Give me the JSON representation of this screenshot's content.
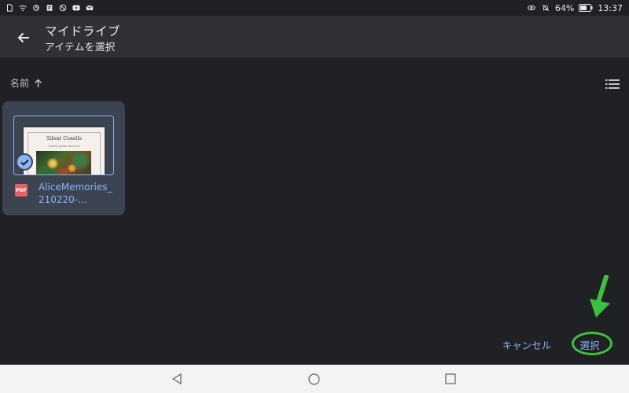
{
  "status_bar": {
    "battery": "64%",
    "time": "13:37",
    "left_icons": [
      "sim-card-icon",
      "wifi-icon",
      "sync-icon",
      "memo-icon",
      "ring-icon",
      "youtube-icon",
      "mail-icon"
    ],
    "right_icons": [
      "eye-icon",
      "bell-off-icon",
      "battery-icon"
    ]
  },
  "app_bar": {
    "title": "マイドライブ",
    "subtitle": "アイテムを選択",
    "back_icon": "arrow-back-icon"
  },
  "sort": {
    "label": "名前",
    "direction_icon": "arrow-up-icon",
    "view_toggle_icon": "list-view-icon"
  },
  "files": [
    {
      "name": "AliceMemories_210220-...",
      "type_label": "PDF",
      "selected": true,
      "thumbnail": {
        "heading": "Silent Coxells",
        "subtitle": "Lorem ipsum dolor sit"
      }
    }
  ],
  "actions": {
    "cancel_label": "キャンセル",
    "select_label": "選択"
  },
  "colors": {
    "background": "#202124",
    "app_bar": "#303134",
    "accent": "#8ab4f8",
    "card_selected": "#3c4452",
    "annotation": "#3fbf3f",
    "nav_bar": "#f1f3f4"
  }
}
